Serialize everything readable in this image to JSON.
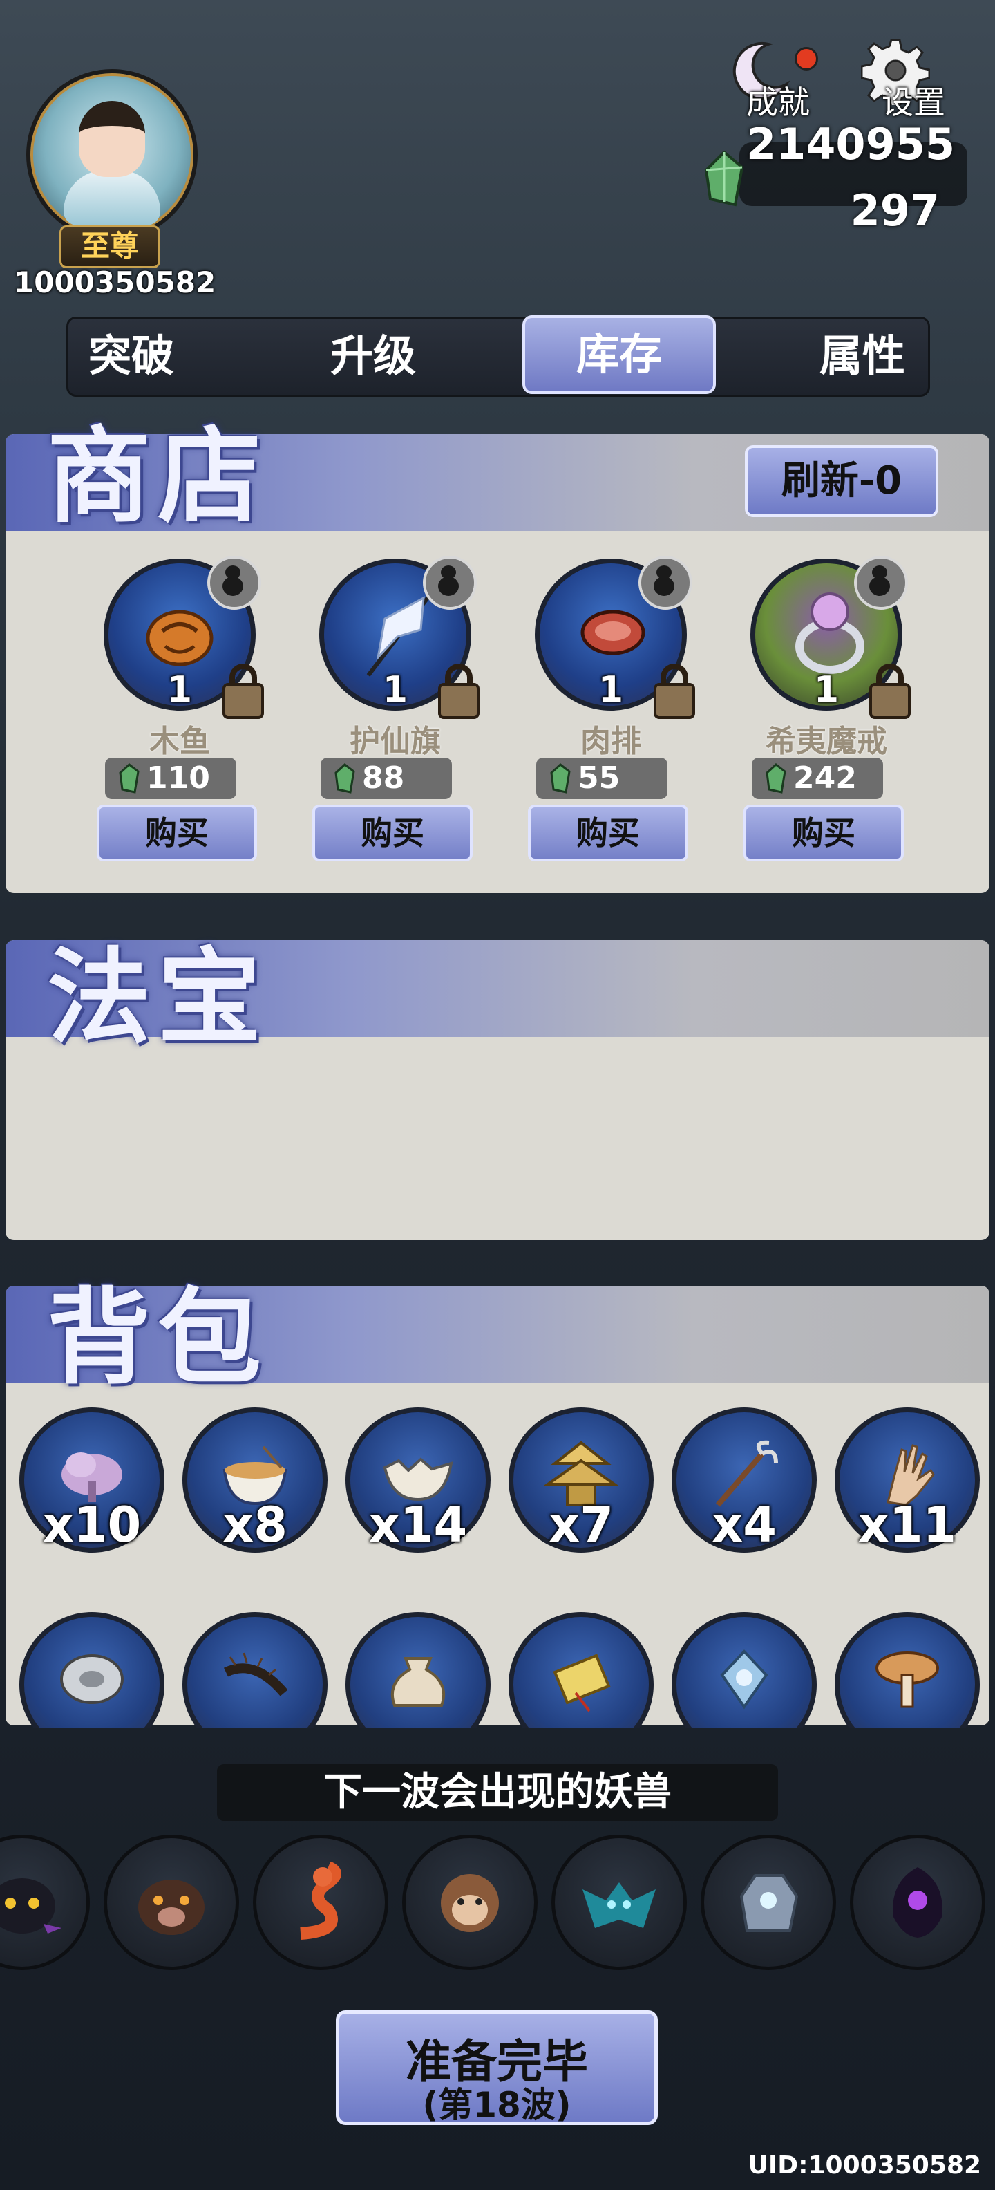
{
  "player": {
    "rank": "至尊",
    "id": "1000350582"
  },
  "top_menu": {
    "achievement_label": "成就",
    "settings_label": "设置"
  },
  "currency": {
    "gold": "2140955",
    "jade": "297"
  },
  "tabs": [
    {
      "label": "突破"
    },
    {
      "label": "升级"
    },
    {
      "label": "库存"
    },
    {
      "label": "属性"
    }
  ],
  "active_tab": "库存",
  "shop": {
    "title": "商店",
    "refresh_label": "刷新-0",
    "items": [
      {
        "name": "木鱼",
        "qty": "1",
        "price": "110",
        "buy_label": "购买",
        "icon": "wooden-fish-icon"
      },
      {
        "name": "护仙旗",
        "qty": "1",
        "price": "88",
        "buy_label": "购买",
        "icon": "banner-icon"
      },
      {
        "name": "肉排",
        "qty": "1",
        "price": "55",
        "buy_label": "购买",
        "icon": "steak-icon"
      },
      {
        "name": "希夷魔戒",
        "qty": "1",
        "price": "242",
        "buy_label": "购买",
        "icon": "ring-icon"
      }
    ]
  },
  "treasure": {
    "title": "法宝"
  },
  "bag": {
    "title": "背包",
    "items": [
      {
        "count": "x10",
        "icon": "cloud-icon"
      },
      {
        "count": "x8",
        "icon": "noodle-bowl-icon"
      },
      {
        "count": "x14",
        "icon": "broken-bowl-icon"
      },
      {
        "count": "x7",
        "icon": "pagoda-icon"
      },
      {
        "count": "x4",
        "icon": "claw-staff-icon"
      },
      {
        "count": "x11",
        "icon": "hand-icon"
      },
      {
        "count": "",
        "icon": "disc-icon"
      },
      {
        "count": "",
        "icon": "centipede-icon"
      },
      {
        "count": "",
        "icon": "pouch-icon"
      },
      {
        "count": "",
        "icon": "scroll-icon"
      },
      {
        "count": "",
        "icon": "pendant-icon"
      },
      {
        "count": "",
        "icon": "mushroom-icon"
      }
    ]
  },
  "next_wave": {
    "label": "下一波会出现的妖兽",
    "monsters": [
      {
        "icon": "shadow-cat-monster-icon"
      },
      {
        "icon": "boar-monster-icon"
      },
      {
        "icon": "red-snake-monster-icon"
      },
      {
        "icon": "monkey-monster-icon"
      },
      {
        "icon": "teal-bat-monster-icon"
      },
      {
        "icon": "stone-golem-monster-icon"
      },
      {
        "icon": "purple-wraith-monster-icon"
      }
    ]
  },
  "ready_button": {
    "label": "准备完毕",
    "wave": "(第18波)"
  },
  "uid_label": "UID:1000350582",
  "colors": {
    "accent_blue": "#7580c8",
    "panel_bg": "#dcdad3",
    "gem_green": "#5fae6a"
  }
}
